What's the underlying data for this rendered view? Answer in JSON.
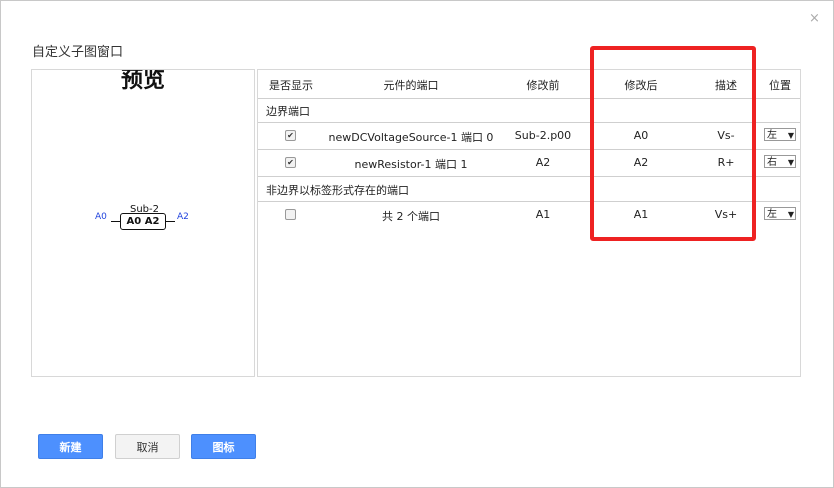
{
  "dialog": {
    "title": "自定义子图窗口",
    "close_icon": "×"
  },
  "preview": {
    "title": "预览",
    "component_name": "Sub-2",
    "component_ports": "A0  A2",
    "left_port": "A0",
    "right_port": "A2"
  },
  "table": {
    "headers": {
      "show": "是否显示",
      "port": "元件的端口",
      "before": "修改前",
      "after": "修改后",
      "desc": "描述",
      "position": "位置"
    },
    "section_boundary": "边界端口",
    "section_nonboundary": "非边界以标签形式存在的端口",
    "rows": [
      {
        "checked": true,
        "port": "newDCVoltageSource-1 端口 0",
        "before": "Sub-2.p00",
        "after": "A0",
        "desc": "Vs-",
        "position": "左"
      },
      {
        "checked": true,
        "port": "newResistor-1 端口 1",
        "before": "A2",
        "after": "A2",
        "desc": "R+",
        "position": "右"
      },
      {
        "checked": false,
        "port": "共 2 个端口",
        "before": "A1",
        "after": "A1",
        "desc": "Vs+",
        "position": "左"
      }
    ]
  },
  "buttons": {
    "new": "新建",
    "cancel": "取消",
    "icon": "图标"
  },
  "colors": {
    "primary": "#4d90fe",
    "highlight": "#ee2222",
    "port_text": "#2244dd"
  }
}
